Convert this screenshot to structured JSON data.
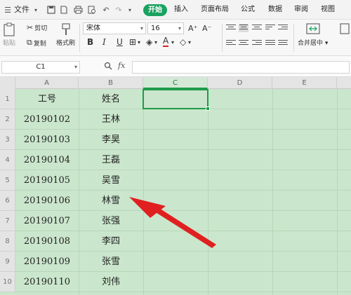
{
  "menubar": {
    "file_label": "文件",
    "start_tab": "开始",
    "tabs": [
      "插入",
      "页面布局",
      "公式",
      "数据",
      "审阅",
      "视图"
    ],
    "accent": "#1aa260"
  },
  "ribbon": {
    "paste": "粘贴",
    "cut": "剪切",
    "copy": "复制",
    "format_painter": "格式刷",
    "font_name": "宋体",
    "font_size": "16",
    "bold": "B",
    "italic": "I",
    "underline": "U",
    "font_color_letter": "A",
    "merge_center": "合并居中",
    "increase_font": "A⁺",
    "decrease_font": "A⁻"
  },
  "formula_bar": {
    "name_box": "C1",
    "fx": "fx",
    "value": ""
  },
  "sheet": {
    "columns": [
      "A",
      "B",
      "C",
      "D",
      "E"
    ],
    "selected_column": "C",
    "row_numbers": [
      "1",
      "2",
      "3",
      "4",
      "5",
      "6",
      "7",
      "8",
      "9",
      "10"
    ],
    "rows": [
      [
        "工号",
        "姓名"
      ],
      [
        "20190102",
        "王林"
      ],
      [
        "20190103",
        "李昊"
      ],
      [
        "20190104",
        "王磊"
      ],
      [
        "20190105",
        "吴雪"
      ],
      [
        "20190106",
        "林雪"
      ],
      [
        "20190107",
        "张强"
      ],
      [
        "20190108",
        "李四"
      ],
      [
        "20190109",
        "张雪"
      ],
      [
        "20190110",
        "刘伟"
      ]
    ],
    "active_cell": "C1",
    "fill_color": "#cae6cc",
    "arrow_color": "#e02020"
  }
}
